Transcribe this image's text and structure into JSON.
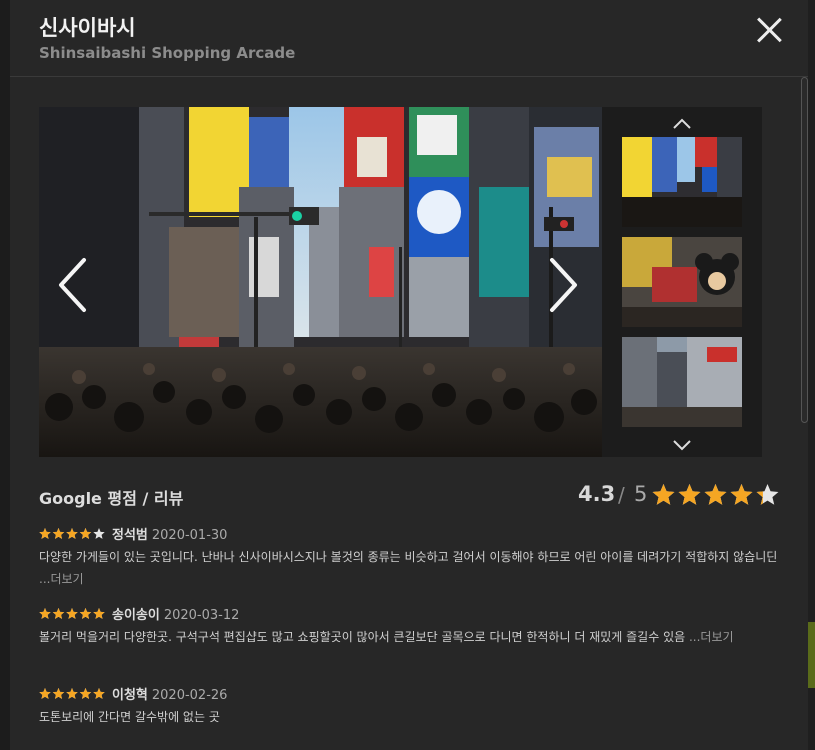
{
  "place": {
    "name_ko": "신사이바시",
    "name_en": "Shinsaibashi Shopping Arcade"
  },
  "icons": {
    "close": "close-icon",
    "prev": "chevron-left-icon",
    "next": "chevron-right-icon",
    "thumb_up": "chevron-up-icon",
    "thumb_down": "chevron-down-icon",
    "star": "star-icon"
  },
  "rating": {
    "title": "Google 평점 / 리뷰",
    "score": "4.3",
    "separator": "/",
    "max": "5",
    "value": 4.3
  },
  "reviews": [
    {
      "stars": 4,
      "author": "정석범",
      "date": "2020-01-30",
      "text": "다양한 가게들이 있는 곳입니다. 난바나 신사이바시스지나 볼것의 종류는 비슷하고 걸어서 이동해야 하므로 어린 아이를 데려가기 적합하지 않습니딘 ",
      "more": "...더보기"
    },
    {
      "stars": 5,
      "author": "송이송이",
      "date": "2020-03-12",
      "text": "볼거리 먹을거리 다양한곳. 구석구석 편집샵도 많고 쇼핑할곳이 많아서 큰길보단 골목으로 다니면 한적하니 더 재밌게 즐길수 있음 ",
      "more": "...더보기"
    },
    {
      "stars": 5,
      "author": "이청혁",
      "date": "2020-02-26",
      "text": "도톤보리에 간다면 갈수밖에 없는 곳",
      "more": ""
    }
  ],
  "colors": {
    "star": "#f5a623",
    "star_empty": "#e6e6e6",
    "modal_bg": "#272727"
  }
}
